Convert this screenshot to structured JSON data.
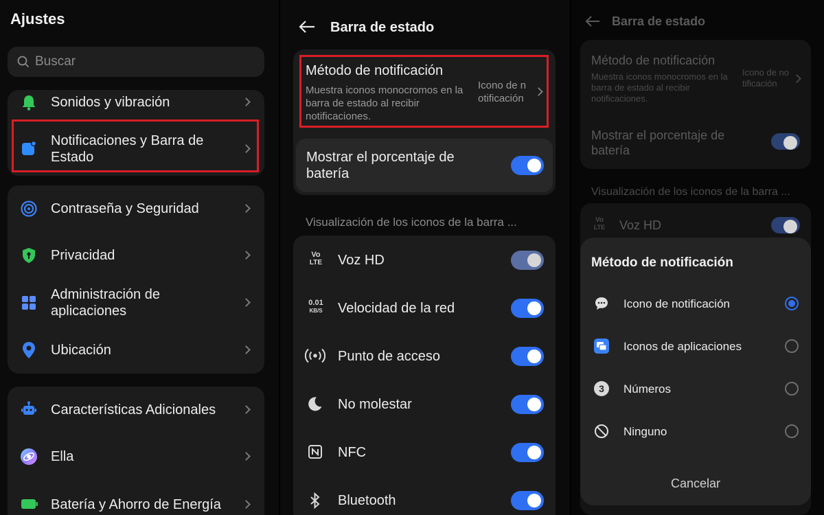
{
  "settings": {
    "title": "Ajustes",
    "search_placeholder": "Buscar",
    "items": [
      {
        "label": "Sonidos y vibración",
        "icon": "bell-icon"
      },
      {
        "label": "Notificaciones y Barra de Estado",
        "icon": "notification-icon"
      },
      {
        "label": "Contraseña y Seguridad",
        "icon": "security-icon"
      },
      {
        "label": "Privacidad",
        "icon": "privacy-shield-icon"
      },
      {
        "label": "Administración de aplicaciones",
        "icon": "apps-grid-icon"
      },
      {
        "label": "Ubicación",
        "icon": "location-pin-icon"
      },
      {
        "label": "Características Adicionales",
        "icon": "robot-icon"
      },
      {
        "label": "Ella",
        "icon": "assistant-icon"
      },
      {
        "label": "Batería y Ahorro de Energía",
        "icon": "battery-icon"
      }
    ]
  },
  "statusbar": {
    "title": "Barra de estado",
    "notif_method": {
      "title": "Método de notificación",
      "description": "Muestra iconos monocromos en la barra de estado al recibir notificaciones.",
      "value": "Icono de notificación"
    },
    "battery_pct": {
      "label": "Mostrar el porcentaje de batería",
      "on": true
    },
    "section_header": "Visualización de los iconos de la barra ...",
    "icon_toggles": [
      {
        "label": "Voz HD",
        "icon": "volte-icon",
        "on": true,
        "dimmed": true
      },
      {
        "label": "Velocidad de la red",
        "icon": "network-speed-icon",
        "on": true
      },
      {
        "label": "Punto de acceso",
        "icon": "hotspot-icon",
        "on": true
      },
      {
        "label": "No molestar",
        "icon": "moon-icon",
        "on": true
      },
      {
        "label": "NFC",
        "icon": "nfc-icon",
        "on": true
      },
      {
        "label": "Bluetooth",
        "icon": "bluetooth-icon",
        "on": true
      }
    ],
    "volte_glyph": [
      "Vo",
      "LTE"
    ],
    "speed_glyph": [
      "0.01",
      "KB/S"
    ]
  },
  "dialog": {
    "title": "Método de notificación",
    "options": [
      {
        "label": "Icono de notificación",
        "icon": "chat-bubble-icon",
        "selected": true
      },
      {
        "label": "Iconos de aplicaciones",
        "icon": "app-icons-icon",
        "selected": false
      },
      {
        "label": "Números",
        "icon": "number-three-icon",
        "selected": false
      },
      {
        "label": "Ninguno",
        "icon": "none-icon",
        "selected": false
      }
    ],
    "cancel_label": "Cancelar",
    "number_glyph": "3"
  },
  "colors": {
    "accent": "#2f6ff2",
    "highlight_box": "#d91e26",
    "card": "#1c1c1c",
    "background": "#0b0b0b"
  }
}
